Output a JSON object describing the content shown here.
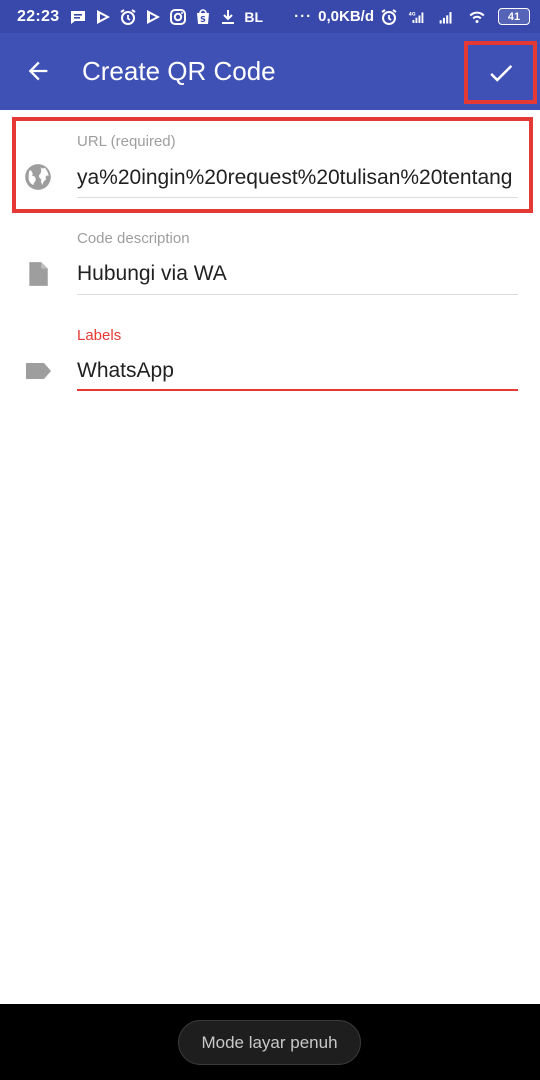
{
  "status_bar": {
    "time": "22:23",
    "carrier_text": "BL",
    "more_dots": "···",
    "network_speed": "0,0KB/d",
    "network_type": "4G",
    "battery_level": "41",
    "icons": [
      "message-icon",
      "play-store-icon",
      "alarm-icon",
      "play-store-icon",
      "instagram-icon",
      "shopee-icon",
      "download-icon"
    ]
  },
  "app_bar": {
    "title": "Create QR Code",
    "back_icon": "arrow-back-icon",
    "confirm_icon": "check-icon",
    "color": "#3f51b5"
  },
  "form": {
    "url": {
      "label": "URL (required)",
      "value": "ya%20ingin%20request%20tulisan%20tentang",
      "icon": "globe-icon"
    },
    "description": {
      "label": "Code description",
      "value": "Hubungi via WA",
      "icon": "document-icon"
    },
    "labels": {
      "label": "Labels",
      "value": "WhatsApp",
      "icon": "label-tag-icon",
      "accent": "#e53935"
    }
  },
  "bottom_bar": {
    "fullscreen_mode": "Mode layar penuh"
  },
  "colors": {
    "status_bar": "#3949ab",
    "app_bar": "#3f51b5",
    "highlight": "#e53935"
  }
}
